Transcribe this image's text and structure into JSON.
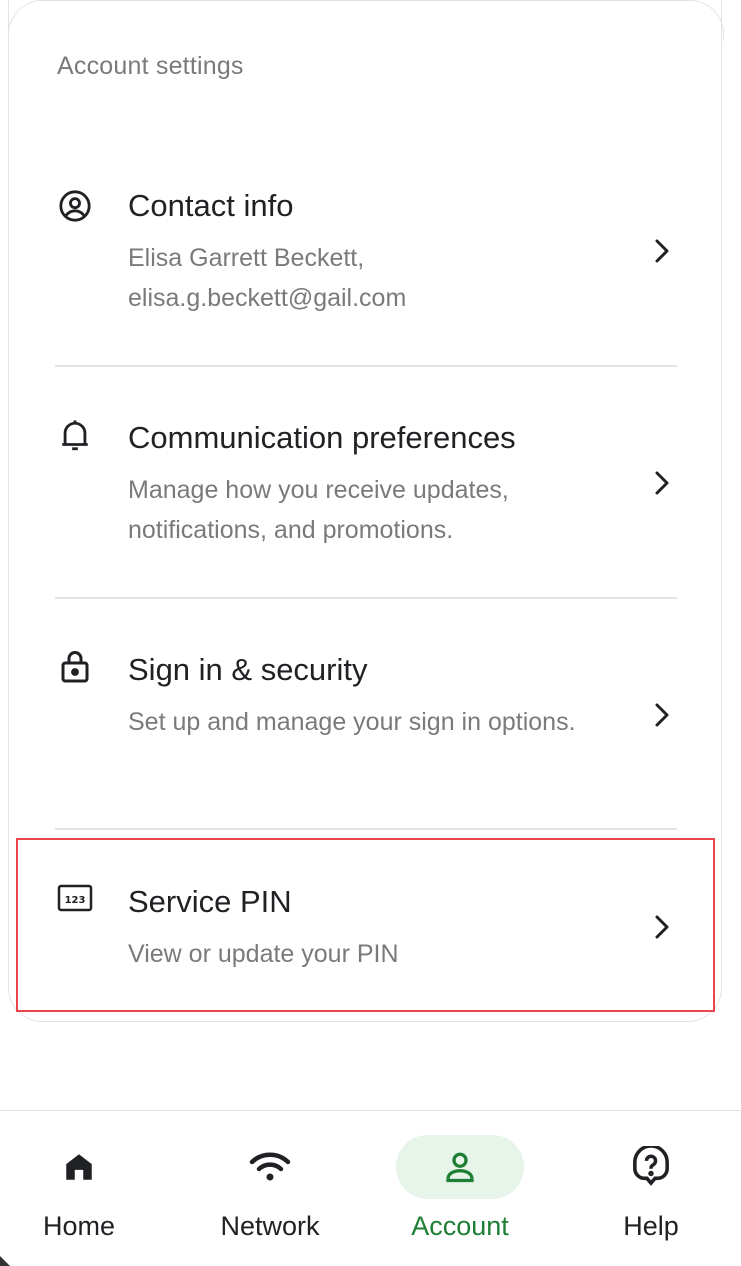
{
  "section_title": "Account settings",
  "rows": [
    {
      "title": "Contact info",
      "desc": "Elisa Garrett Beckett, elisa.g.beckett@gail.com",
      "icon": "account-circle-icon"
    },
    {
      "title": "Communication preferences",
      "desc": "Manage how you receive updates, notifications, and promotions.",
      "icon": "bell-icon"
    },
    {
      "title": "Sign in & security",
      "desc": "Set up and manage your sign in options.",
      "icon": "lock-icon"
    },
    {
      "title": "Service PIN",
      "desc": "View or update your PIN",
      "icon": "pin-123-icon"
    }
  ],
  "nav": {
    "items": [
      {
        "label": "Home",
        "icon": "home-icon"
      },
      {
        "label": "Network",
        "icon": "wifi-icon"
      },
      {
        "label": "Account",
        "icon": "person-icon",
        "active": true
      },
      {
        "label": "Help",
        "icon": "help-icon"
      }
    ]
  },
  "colors": {
    "accent": "#1e7e34",
    "accent_bg": "#e6f4ea",
    "highlight": "#e8444a",
    "muted_text": "#7a7a7a"
  }
}
